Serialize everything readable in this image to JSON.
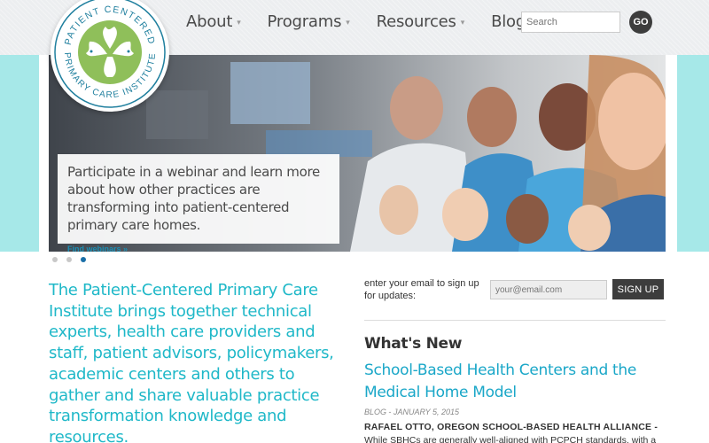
{
  "logo": {
    "top_text": "PATIENT CENTERED",
    "bottom_text": "PRIMARY CARE INSTITUTE",
    "colors": {
      "ring": "#1f7f9e",
      "leaf": "#8fbf5a"
    }
  },
  "nav": {
    "items": [
      {
        "label": "About",
        "caret": "▾"
      },
      {
        "label": "Programs",
        "caret": "▾"
      },
      {
        "label": "Resources",
        "caret": "▾"
      },
      {
        "label": "Blog"
      }
    ]
  },
  "search": {
    "placeholder": "Search",
    "button_label": "GO"
  },
  "hero": {
    "caption": "Participate in a webinar and learn more about how other practices are transforming into patient-centered primary care homes.",
    "link": "Find webinars »",
    "slides": 3,
    "active_slide": 3
  },
  "intro": "The Patient-Centered Primary Care Institute brings together technical experts, health care providers and staff, patient advisors, policymakers, academic centers and others to gather and share valuable practice transformation knowledge and resources.",
  "signup": {
    "label": "enter your email to sign up for updates:",
    "placeholder": "your@email.com",
    "button_label": "SIGN UP"
  },
  "whats_new": {
    "heading": "What's New",
    "post": {
      "title": "School-Based Health Centers and the Medical Home Model",
      "category": "BLOG",
      "date": "JANUARY 5, 2015",
      "author": "RAFAEL OTTO, OREGON SCHOOL-BASED HEALTH ALLIANCE -",
      "excerpt": "While SBHCs are generally well-aligned with PCPCH standards, with a"
    }
  },
  "colors": {
    "accent": "#1fb8c8",
    "link": "#1aa7c8",
    "band": "#a6e8e8",
    "dark_button": "#3d3d3d"
  }
}
